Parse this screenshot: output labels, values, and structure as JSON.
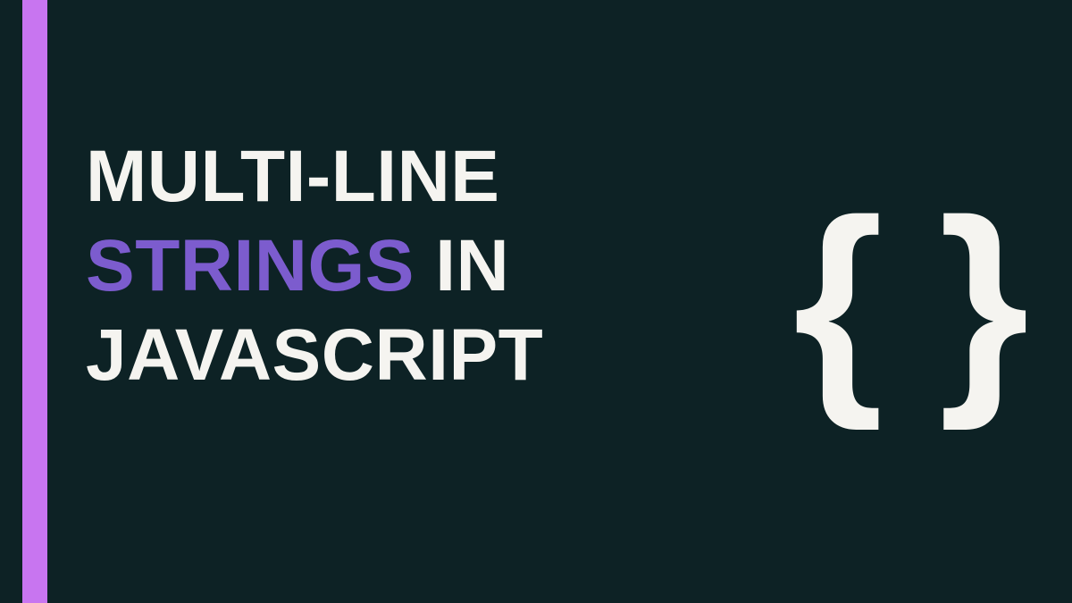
{
  "colors": {
    "background": "#0d2225",
    "accent": "#c875f0",
    "text": "#f5f4f0",
    "highlight": "#7c5cce"
  },
  "title": {
    "line1": "Multi-line",
    "line2_highlight": "Strings",
    "line2_rest": " in",
    "line3": "JavaScript"
  },
  "icon": {
    "left_brace": "{",
    "right_brace": "}"
  }
}
